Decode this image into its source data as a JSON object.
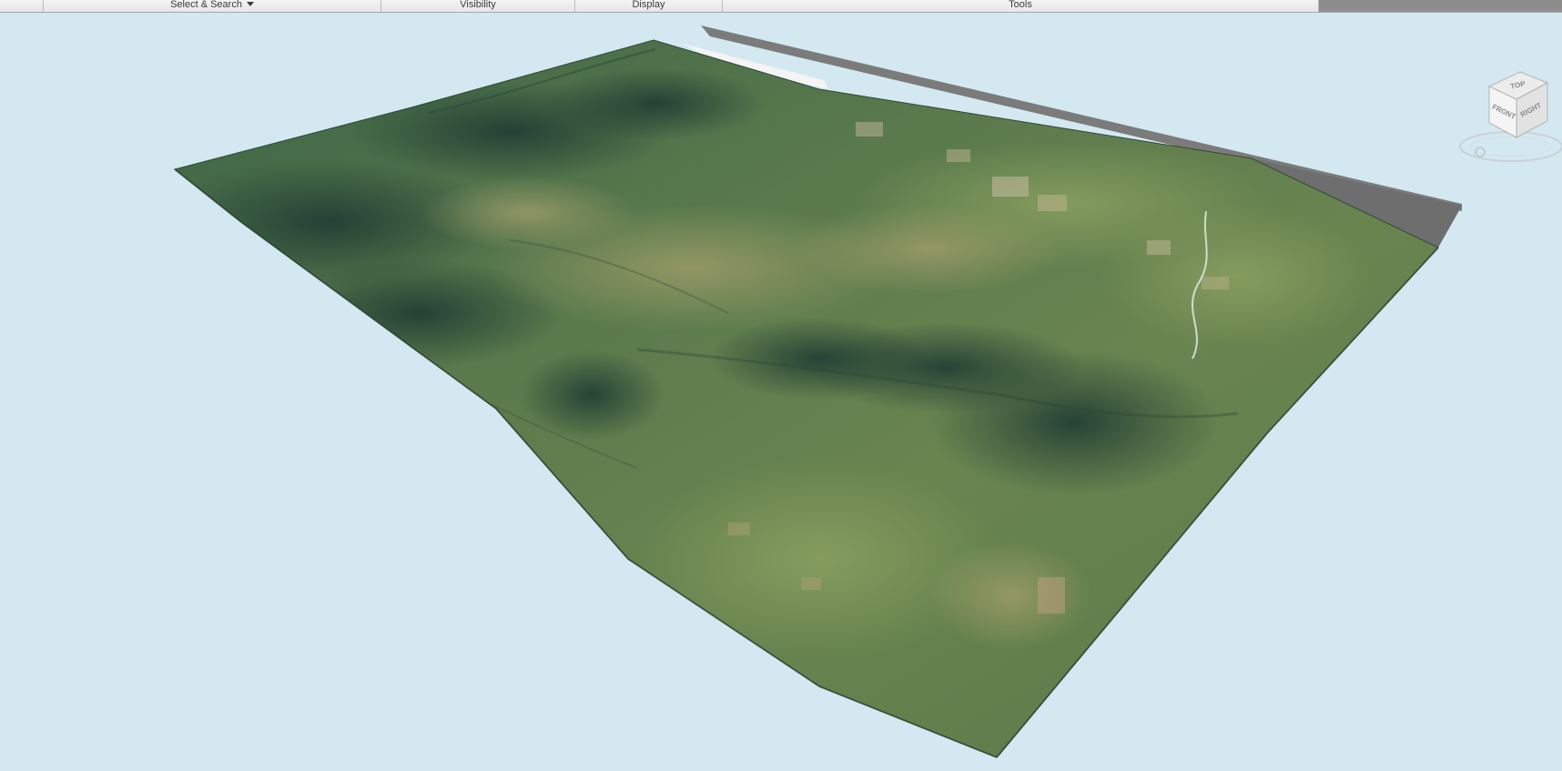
{
  "ribbon": {
    "panels": [
      {
        "label": ""
      },
      {
        "label": "Select & Search",
        "has_dropdown": true
      },
      {
        "label": "Visibility"
      },
      {
        "label": "Display"
      },
      {
        "label": "Tools"
      },
      {
        "label": ""
      }
    ]
  },
  "viewport": {
    "background_color": "#d4e8f1",
    "content": "terrain-surface"
  },
  "viewcube": {
    "faces": {
      "top": "TOP",
      "front": "FRONT",
      "right": "RIGHT"
    }
  }
}
